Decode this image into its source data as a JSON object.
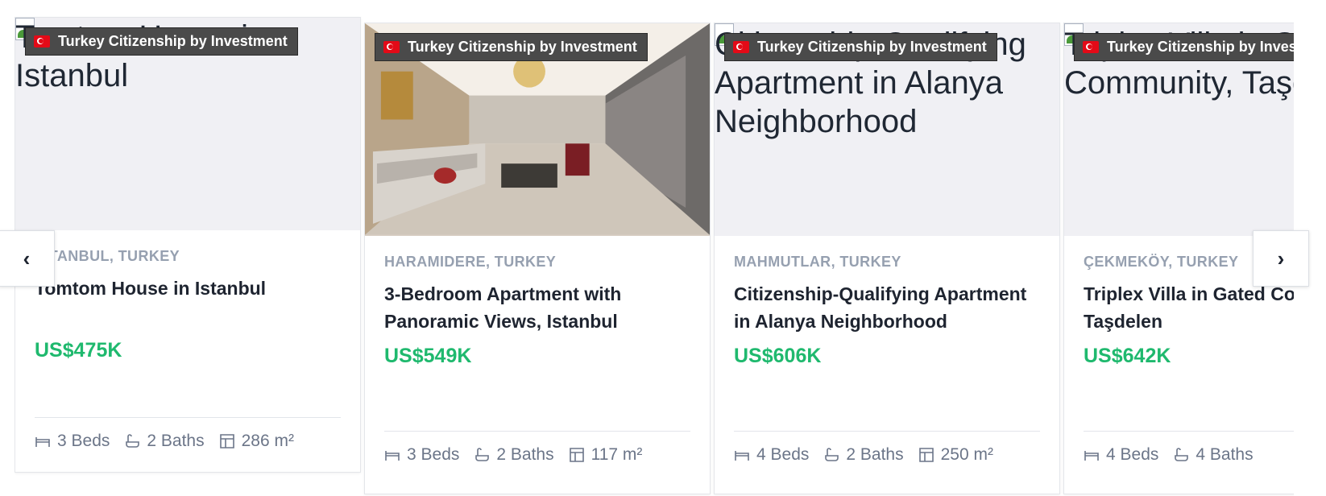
{
  "badge_text": "Turkey Citizenship by Investment",
  "nav": {
    "prev": "‹",
    "next": "›"
  },
  "cards": [
    {
      "image_alt": "Tomtom House in Istanbul",
      "location": "ISTANBUL, TURKEY",
      "title": "Tomtom House in Istanbul",
      "price": "US$475K",
      "beds": "3 Beds",
      "baths": "2 Baths",
      "area": "286 m²"
    },
    {
      "image_alt": "",
      "location": "HARAMIDERE, TURKEY",
      "title": "3-Bedroom Apartment with Panoramic Views, Istanbul",
      "price": "US$549K",
      "beds": "3 Beds",
      "baths": "2 Baths",
      "area": "117 m²"
    },
    {
      "image_alt": "Citizenship-Qualifying Apartment in Alanya Neighborhood",
      "location": "MAHMUTLAR, TURKEY",
      "title": "Citizenship-Qualifying Apartment in Alanya Neighborhood",
      "price": "US$606K",
      "beds": "4 Beds",
      "baths": "2 Baths",
      "area": "250 m²"
    },
    {
      "image_alt": "Triplex Villa in Gated Community, Taşdelen",
      "location": "ÇEKMEKÖY, TURKEY",
      "title": "Triplex Villa in Gated Community, Taşdelen",
      "price": "US$642K",
      "beds": "4 Beds",
      "baths": "4 Baths",
      "area": ""
    }
  ],
  "colors": {
    "price": "#1fb96e",
    "badge_bg": "#4a4a4a",
    "location": "#96a0b0"
  },
  "icons": {
    "beds": "bed-icon",
    "baths": "bath-icon",
    "area": "area-icon",
    "flag": "turkey-flag-icon"
  }
}
